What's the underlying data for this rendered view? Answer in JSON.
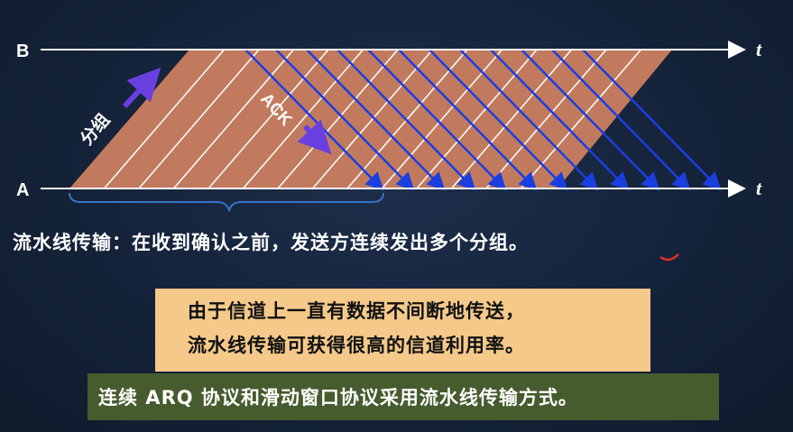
{
  "diagram": {
    "label_b": "B",
    "label_a": "A",
    "time_label_top": "t",
    "time_label_bottom": "t",
    "packet_label": "分组",
    "ack_label": "ACK"
  },
  "caption": "流水线传输：在收到确认之前，发送方连续发出多个分组。",
  "note": {
    "line1": "由于信道上一直有数据不间断地传送，",
    "line2": "流水线传输可获得很高的信道利用率。"
  },
  "subtitle": "连续 ARQ 协议和滑动窗口协议采用流水线传输方式。",
  "colors": {
    "packet_fill": "#c27a5e",
    "ack_arrow": "#1a3fe0",
    "timeline": "#ffffff",
    "label_arrow": "#6a3fe0",
    "note_bg": "#f4c98a",
    "subtitle_bg": "#465c2f",
    "annotation_red": "#e0302a"
  }
}
